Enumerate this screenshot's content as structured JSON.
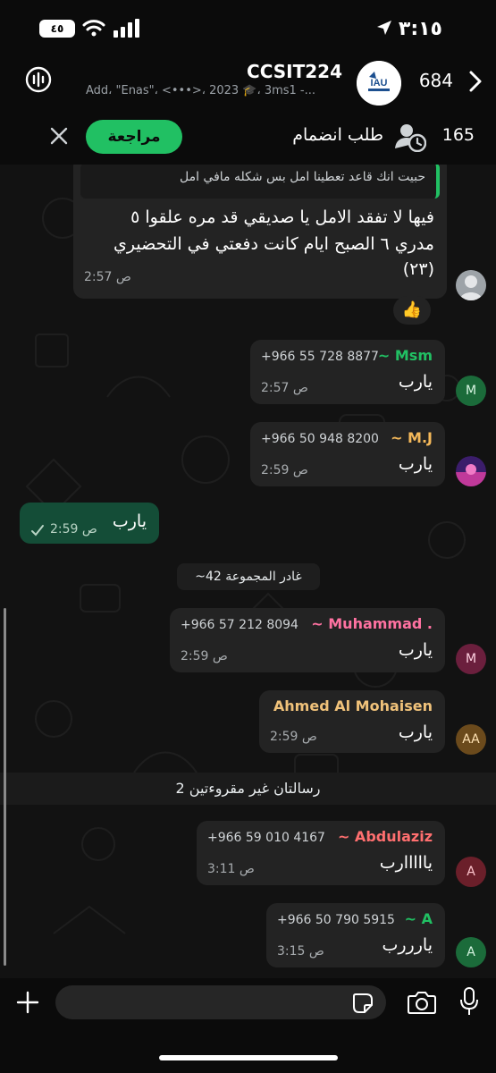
{
  "status_bar": {
    "time": "٣:١٥",
    "battery": "٤٥"
  },
  "header": {
    "title": "CCSIT224",
    "subtitle": "Add، \"Enas\"، <•••>، 2023 🎓، 3ms1 -...",
    "member_count": "684"
  },
  "join_bar": {
    "review_label": "مراجعة",
    "label": "طلب انضمام",
    "count": "165"
  },
  "messages": {
    "m1": {
      "quoted": "حبيت انك قاعد تعطينا امل بس شكله مافي امل",
      "line1": "فيها لا تفقد الامل يا صديقي قد مره علقوا ٥",
      "line2": "مدري ٦ الصبح ايام كانت دفعتي في التحضيري",
      "line3": "(٢٣)",
      "time": "2:57 ص",
      "reaction": "👍"
    },
    "m2": {
      "sender": "~ Msm",
      "phone": "+966 55 728 8877",
      "text": "يارب",
      "time": "2:57 ص",
      "avatar": "M"
    },
    "m3": {
      "sender": "~ M.J",
      "phone": "+966 50 948 8200",
      "text": "يارب",
      "time": "2:59 ص"
    },
    "m4": {
      "text": "يارب",
      "time": "2:59 ص"
    },
    "system_left": "‎~42 غادر المجموعة",
    "m5": {
      "sender": "~ Muhammad .",
      "phone": "+966 57 212 8094",
      "text": "يارب",
      "time": "2:59 ص",
      "avatar": "M"
    },
    "m6": {
      "sender": "Ahmed Al Mohaisen",
      "text": "يارب",
      "time": "2:59 ص",
      "avatar": "AA"
    },
    "unread": "2 رسالتان غير مقروءتين",
    "m7": {
      "sender": "~ Abdulaziz",
      "phone": "+966 59 010 4167",
      "text": "يااااارب",
      "time": "3:11 ص",
      "avatar": "A"
    },
    "m8": {
      "sender": "~ A",
      "phone": "+966 50 790 5915",
      "text": "يارررب",
      "time": "3:15 ص",
      "avatar": "A"
    }
  },
  "colors": {
    "accent_green": "#21c063",
    "sender_msm": "#21c063",
    "sender_mj": "#f5b95a",
    "sender_muhammad": "#ff72a1",
    "sender_ahmed": "#f0c27a",
    "sender_abdulaziz": "#ff6f6f",
    "sender_a": "#21c063"
  },
  "icons": [
    "location-arrow-icon",
    "wifi-icon",
    "signal-icon",
    "battery-icon",
    "chevron-right-icon",
    "voice-chat-icon",
    "close-icon",
    "join-request-icon",
    "plus-icon",
    "sticker-icon",
    "camera-icon",
    "microphone-icon",
    "check-icon"
  ]
}
